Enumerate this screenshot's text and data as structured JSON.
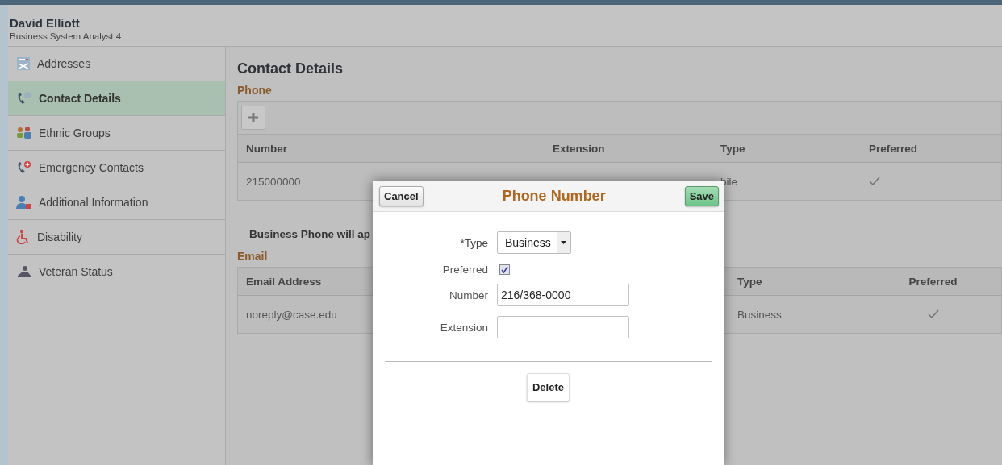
{
  "header": {
    "name": "David Elliott",
    "subtitle": "Business System Analyst 4"
  },
  "sidebar": {
    "items": [
      {
        "label": "Addresses",
        "selected": false
      },
      {
        "label": "Contact Details",
        "selected": true
      },
      {
        "label": "Ethnic Groups",
        "selected": false
      },
      {
        "label": "Emergency Contacts",
        "selected": false
      },
      {
        "label": "Additional Information",
        "selected": false
      },
      {
        "label": "Disability",
        "selected": false
      },
      {
        "label": "Veteran Status",
        "selected": false
      }
    ]
  },
  "content": {
    "title": "Contact Details",
    "phone": {
      "heading": "Phone",
      "columns": [
        "Number",
        "Extension",
        "Type",
        "Preferred"
      ],
      "rows": [
        {
          "number": "215000000",
          "type": "bile",
          "preferred": true
        }
      ]
    },
    "notice": "Business Phone will ap",
    "email": {
      "heading": "Email",
      "columns": [
        "Email Address",
        "Type",
        "Preferred"
      ],
      "rows": [
        {
          "email_address": "noreply@case.edu",
          "type": "Business",
          "preferred": true
        }
      ]
    }
  },
  "dialog": {
    "title": "Phone Number",
    "cancel": "Cancel",
    "save": "Save",
    "delete": "Delete",
    "fields": [
      {
        "kind": "select",
        "label": "*Type",
        "value": "Business"
      },
      {
        "kind": "checkbox",
        "label": "Preferred",
        "checked": true
      },
      {
        "kind": "text",
        "label": "Number",
        "value": "216/368-0000"
      },
      {
        "kind": "text",
        "label": "Extension"
      }
    ]
  }
}
